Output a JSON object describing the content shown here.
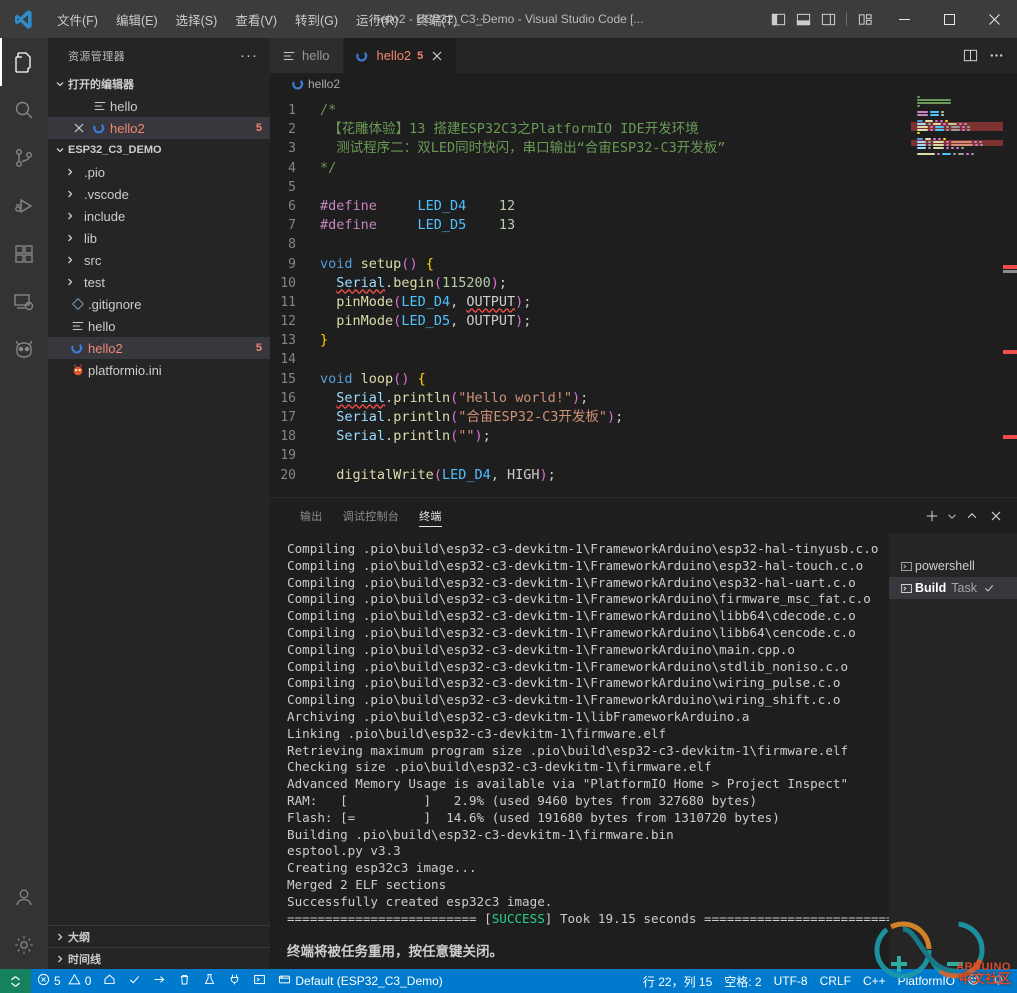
{
  "titlebar": {
    "title": "hello2 - ESP32_C3_Demo - Visual Studio Code [...",
    "menus": [
      "文件(F)",
      "编辑(E)",
      "选择(S)",
      "查看(V)",
      "转到(G)",
      "运行(R)",
      "终端(T)",
      "···"
    ],
    "layout_icons": [
      "panel-left-icon",
      "panel-bottom-icon",
      "panel-right-icon",
      "customize-layout-icon"
    ],
    "window_controls": [
      "minimize-icon",
      "maximize-icon",
      "close-icon"
    ]
  },
  "activitybar": {
    "items": [
      {
        "name": "explorer",
        "icon": "files-icon",
        "active": true
      },
      {
        "name": "search",
        "icon": "search-icon",
        "active": false
      },
      {
        "name": "source-control",
        "icon": "source-control-icon",
        "active": false
      },
      {
        "name": "run-and-debug",
        "icon": "debug-icon",
        "active": false
      },
      {
        "name": "extensions",
        "icon": "extensions-icon",
        "active": false
      },
      {
        "name": "remote-explorer",
        "icon": "remote-icon",
        "active": false
      },
      {
        "name": "platformio",
        "icon": "platformio-alien-icon",
        "active": false
      }
    ],
    "bottom": [
      {
        "name": "accounts",
        "icon": "account-icon"
      },
      {
        "name": "manage",
        "icon": "gear-icon"
      }
    ]
  },
  "sidebar": {
    "title": "资源管理器",
    "more_label": "···",
    "open_editors": {
      "label": "打开的编辑器",
      "items": [
        {
          "name": "hello",
          "icon": "file-text-icon",
          "badge": "",
          "selected": false,
          "error": false
        },
        {
          "name": "hello2",
          "icon": "cpp-icon",
          "badge": "5",
          "selected": true,
          "error": true
        }
      ]
    },
    "project": {
      "label": "ESP32_C3_DEMO",
      "items": [
        {
          "name": ".pio",
          "type": "folder",
          "badge": ""
        },
        {
          "name": ".vscode",
          "type": "folder",
          "badge": ""
        },
        {
          "name": "include",
          "type": "folder",
          "badge": ""
        },
        {
          "name": "lib",
          "type": "folder",
          "badge": ""
        },
        {
          "name": "src",
          "type": "folder",
          "badge": ""
        },
        {
          "name": "test",
          "type": "folder",
          "badge": ""
        },
        {
          "name": ".gitignore",
          "type": "git",
          "badge": ""
        },
        {
          "name": "hello",
          "type": "file-text",
          "badge": ""
        },
        {
          "name": "hello2",
          "type": "cpp",
          "badge": "5",
          "selected": true,
          "error": true
        },
        {
          "name": "platformio.ini",
          "type": "platformio",
          "badge": ""
        }
      ]
    },
    "collapsed_sections": [
      "大纲",
      "时间线"
    ]
  },
  "editor": {
    "tabs": [
      {
        "label": "hello",
        "icon": "file-text-icon",
        "badge": "",
        "active": false,
        "closable": false
      },
      {
        "label": "hello2",
        "icon": "cpp-icon",
        "badge": "5",
        "active": true,
        "closable": true
      }
    ],
    "tab_actions": [
      "split-editor-icon",
      "more-actions-icon"
    ],
    "breadcrumb": {
      "label": "hello2",
      "icon": "cpp-icon"
    },
    "lines": [
      {
        "n": "1",
        "tokens": [
          {
            "t": "/*",
            "c": "comment",
            "indent": 0
          }
        ]
      },
      {
        "n": "2",
        "tokens": [
          {
            "t": " 【花雕体验】13 搭建ESP32C3之PlatformIO IDE开发环境",
            "c": "comment",
            "indent": 0
          }
        ]
      },
      {
        "n": "3",
        "tokens": [
          {
            "t": "  测试程序二：双LED同时快闪，串口输出“合宙ESP32-C3开发板”",
            "c": "comment",
            "indent": 0
          }
        ]
      },
      {
        "n": "4",
        "tokens": [
          {
            "t": "*/",
            "c": "comment",
            "indent": 0
          }
        ]
      },
      {
        "n": "5",
        "tokens": []
      },
      {
        "n": "6",
        "tokens": [
          {
            "t": "#define",
            "c": "pre"
          },
          {
            "t": "     ",
            "c": "plain"
          },
          {
            "t": "LED_D4",
            "c": "macro"
          },
          {
            "t": "    ",
            "c": "plain"
          },
          {
            "t": "12",
            "c": "num"
          }
        ]
      },
      {
        "n": "7",
        "tokens": [
          {
            "t": "#define",
            "c": "pre"
          },
          {
            "t": "     ",
            "c": "plain"
          },
          {
            "t": "LED_D5",
            "c": "macro"
          },
          {
            "t": "    ",
            "c": "plain"
          },
          {
            "t": "13",
            "c": "num"
          }
        ]
      },
      {
        "n": "8",
        "tokens": []
      },
      {
        "n": "9",
        "tokens": [
          {
            "t": "void",
            "c": "kw"
          },
          {
            "t": " ",
            "c": "plain"
          },
          {
            "t": "setup",
            "c": "fn"
          },
          {
            "t": "(",
            "c": "paren"
          },
          {
            "t": ")",
            "c": "paren"
          },
          {
            "t": " ",
            "c": "plain"
          },
          {
            "t": "{",
            "c": "brace"
          }
        ]
      },
      {
        "n": "10",
        "tokens": [
          {
            "t": "  ",
            "c": "plain"
          },
          {
            "t": "Serial",
            "c": "obj",
            "err": true
          },
          {
            "t": ".",
            "c": "punct"
          },
          {
            "t": "begin",
            "c": "fn"
          },
          {
            "t": "(",
            "c": "paren"
          },
          {
            "t": "115200",
            "c": "num"
          },
          {
            "t": ")",
            "c": "paren"
          },
          {
            "t": ";",
            "c": "punct"
          }
        ]
      },
      {
        "n": "11",
        "tokens": [
          {
            "t": "  ",
            "c": "plain"
          },
          {
            "t": "pinMode",
            "c": "fn"
          },
          {
            "t": "(",
            "c": "paren"
          },
          {
            "t": "LED_D4",
            "c": "const"
          },
          {
            "t": ", ",
            "c": "punct"
          },
          {
            "t": "OUTPUT",
            "c": "plain",
            "err": true
          },
          {
            "t": ")",
            "c": "paren"
          },
          {
            "t": ";",
            "c": "punct"
          }
        ]
      },
      {
        "n": "12",
        "tokens": [
          {
            "t": "  ",
            "c": "plain"
          },
          {
            "t": "pinMode",
            "c": "fn"
          },
          {
            "t": "(",
            "c": "paren"
          },
          {
            "t": "LED_D5",
            "c": "const"
          },
          {
            "t": ", ",
            "c": "punct"
          },
          {
            "t": "OUTPUT",
            "c": "plain"
          },
          {
            "t": ")",
            "c": "paren"
          },
          {
            "t": ";",
            "c": "punct"
          }
        ]
      },
      {
        "n": "13",
        "tokens": [
          {
            "t": "}",
            "c": "brace"
          }
        ]
      },
      {
        "n": "14",
        "tokens": []
      },
      {
        "n": "15",
        "tokens": [
          {
            "t": "void",
            "c": "kw"
          },
          {
            "t": " ",
            "c": "plain"
          },
          {
            "t": "loop",
            "c": "fn"
          },
          {
            "t": "(",
            "c": "paren"
          },
          {
            "t": ")",
            "c": "paren"
          },
          {
            "t": " ",
            "c": "plain"
          },
          {
            "t": "{",
            "c": "brace"
          }
        ]
      },
      {
        "n": "16",
        "tokens": [
          {
            "t": "  ",
            "c": "plain"
          },
          {
            "t": "Serial",
            "c": "obj",
            "err": true
          },
          {
            "t": ".",
            "c": "punct"
          },
          {
            "t": "println",
            "c": "fn"
          },
          {
            "t": "(",
            "c": "paren"
          },
          {
            "t": "\"Hello world!\"",
            "c": "str"
          },
          {
            "t": ")",
            "c": "paren"
          },
          {
            "t": ";",
            "c": "punct"
          }
        ]
      },
      {
        "n": "17",
        "tokens": [
          {
            "t": "  ",
            "c": "plain"
          },
          {
            "t": "Serial",
            "c": "obj"
          },
          {
            "t": ".",
            "c": "punct"
          },
          {
            "t": "println",
            "c": "fn"
          },
          {
            "t": "(",
            "c": "paren"
          },
          {
            "t": "\"合宙ESP32-C3开发板\"",
            "c": "str"
          },
          {
            "t": ")",
            "c": "paren"
          },
          {
            "t": ";",
            "c": "punct"
          }
        ]
      },
      {
        "n": "18",
        "tokens": [
          {
            "t": "  ",
            "c": "plain"
          },
          {
            "t": "Serial",
            "c": "obj"
          },
          {
            "t": ".",
            "c": "punct"
          },
          {
            "t": "println",
            "c": "fn"
          },
          {
            "t": "(",
            "c": "paren"
          },
          {
            "t": "\"\"",
            "c": "str"
          },
          {
            "t": ")",
            "c": "paren"
          },
          {
            "t": ";",
            "c": "punct"
          }
        ]
      },
      {
        "n": "19",
        "tokens": []
      },
      {
        "n": "20",
        "tokens": [
          {
            "t": "  ",
            "c": "plain"
          },
          {
            "t": "digitalWrite",
            "c": "fn"
          },
          {
            "t": "(",
            "c": "paren"
          },
          {
            "t": "LED_D4",
            "c": "const"
          },
          {
            "t": ", ",
            "c": "punct"
          },
          {
            "t": "HIGH",
            "c": "plain"
          },
          {
            "t": ")",
            "c": "paren"
          },
          {
            "t": ";",
            "c": "punct"
          }
        ]
      }
    ]
  },
  "panel": {
    "tabs": [
      {
        "label": "输出",
        "active": false
      },
      {
        "label": "调试控制台",
        "active": false
      },
      {
        "label": "终端",
        "active": true
      }
    ],
    "actions": [
      "add-terminal-icon",
      "chevron-down-icon",
      "maximize-panel-icon",
      "close-panel-icon"
    ],
    "terminal_lines": [
      {
        "text": "Compiling .pio\\build\\esp32-c3-devkitm-1\\FrameworkArduino\\esp32-hal-tinyusb.c.o"
      },
      {
        "text": "Compiling .pio\\build\\esp32-c3-devkitm-1\\FrameworkArduino\\esp32-hal-touch.c.o"
      },
      {
        "text": "Compiling .pio\\build\\esp32-c3-devkitm-1\\FrameworkArduino\\esp32-hal-uart.c.o"
      },
      {
        "text": "Compiling .pio\\build\\esp32-c3-devkitm-1\\FrameworkArduino\\firmware_msc_fat.c.o"
      },
      {
        "text": "Compiling .pio\\build\\esp32-c3-devkitm-1\\FrameworkArduino\\libb64\\cdecode.c.o"
      },
      {
        "text": "Compiling .pio\\build\\esp32-c3-devkitm-1\\FrameworkArduino\\libb64\\cencode.c.o"
      },
      {
        "text": "Compiling .pio\\build\\esp32-c3-devkitm-1\\FrameworkArduino\\main.cpp.o"
      },
      {
        "text": "Compiling .pio\\build\\esp32-c3-devkitm-1\\FrameworkArduino\\stdlib_noniso.c.o"
      },
      {
        "text": "Compiling .pio\\build\\esp32-c3-devkitm-1\\FrameworkArduino\\wiring_pulse.c.o"
      },
      {
        "text": "Compiling .pio\\build\\esp32-c3-devkitm-1\\FrameworkArduino\\wiring_shift.c.o"
      },
      {
        "text": "Archiving .pio\\build\\esp32-c3-devkitm-1\\libFrameworkArduino.a"
      },
      {
        "text": "Linking .pio\\build\\esp32-c3-devkitm-1\\firmware.elf"
      },
      {
        "text": "Retrieving maximum program size .pio\\build\\esp32-c3-devkitm-1\\firmware.elf"
      },
      {
        "text": "Checking size .pio\\build\\esp32-c3-devkitm-1\\firmware.elf"
      },
      {
        "text": "Advanced Memory Usage is available via \"PlatformIO Home > Project Inspect\""
      },
      {
        "text": "RAM:   [          ]   2.9% (used 9460 bytes from 327680 bytes)"
      },
      {
        "text": "Flash: [=         ]  14.6% (used 191680 bytes from 1310720 bytes)"
      },
      {
        "text": "Building .pio\\build\\esp32-c3-devkitm-1\\firmware.bin"
      },
      {
        "text": "esptool.py v3.3"
      },
      {
        "text": "Creating esp32c3 image..."
      },
      {
        "text": "Merged 2 ELF sections"
      },
      {
        "text": "Successfully created esp32c3 image."
      }
    ],
    "success_line": {
      "prefix": "========================= [",
      "status": "SUCCESS",
      "suffix": "] Took 19.15 seconds ==========================="
    },
    "closing_note": "终端将被任务重用，按任意键关闭。",
    "terminal_list": [
      {
        "name": "powershell",
        "sub": "",
        "check": false,
        "selected": false
      },
      {
        "name": "Build",
        "sub": "Task",
        "check": true,
        "selected": true
      }
    ]
  },
  "statusbar": {
    "remote_icon": "remote-indicator-icon",
    "left": [
      {
        "name": "problems",
        "icon": "error-icon",
        "text": "5",
        "icon2": "warning-icon",
        "text2": "0"
      },
      {
        "name": "pio-home",
        "icon": "home-icon",
        "text": ""
      },
      {
        "name": "pio-build",
        "icon": "check-icon",
        "text": ""
      },
      {
        "name": "pio-upload",
        "icon": "arrow-right-icon",
        "text": ""
      },
      {
        "name": "pio-clean",
        "icon": "trash-icon",
        "text": ""
      },
      {
        "name": "pio-test",
        "icon": "beaker-icon",
        "text": ""
      },
      {
        "name": "pio-serial-monitor",
        "icon": "plug-icon",
        "text": ""
      },
      {
        "name": "pio-terminal",
        "icon": "terminal-icon",
        "text": ""
      },
      {
        "name": "pio-project-env",
        "icon": "folder-env-icon",
        "text": "Default (ESP32_C3_Demo)"
      }
    ],
    "right": [
      {
        "name": "cursor-position",
        "text": "行 22，列 15"
      },
      {
        "name": "indentation",
        "text": "空格: 2"
      },
      {
        "name": "encoding",
        "text": "UTF-8"
      },
      {
        "name": "eol",
        "text": "CRLF"
      },
      {
        "name": "language-mode",
        "text": "C++"
      },
      {
        "name": "platformio-status",
        "text": "PlatformIO"
      },
      {
        "name": "feedback",
        "text": ""
      },
      {
        "name": "notifications",
        "text": ""
      }
    ]
  },
  "watermark": {
    "line1": "ARDUINO",
    "line2": "中文社区"
  },
  "colors": {
    "accent": "#007acc",
    "error": "#f48771",
    "success": "#23d18b",
    "remote": "#16825d",
    "titlebar": "#3c3c3c",
    "sidebar": "#252526",
    "editor": "#1e1e1e",
    "activitybar": "#333333"
  }
}
